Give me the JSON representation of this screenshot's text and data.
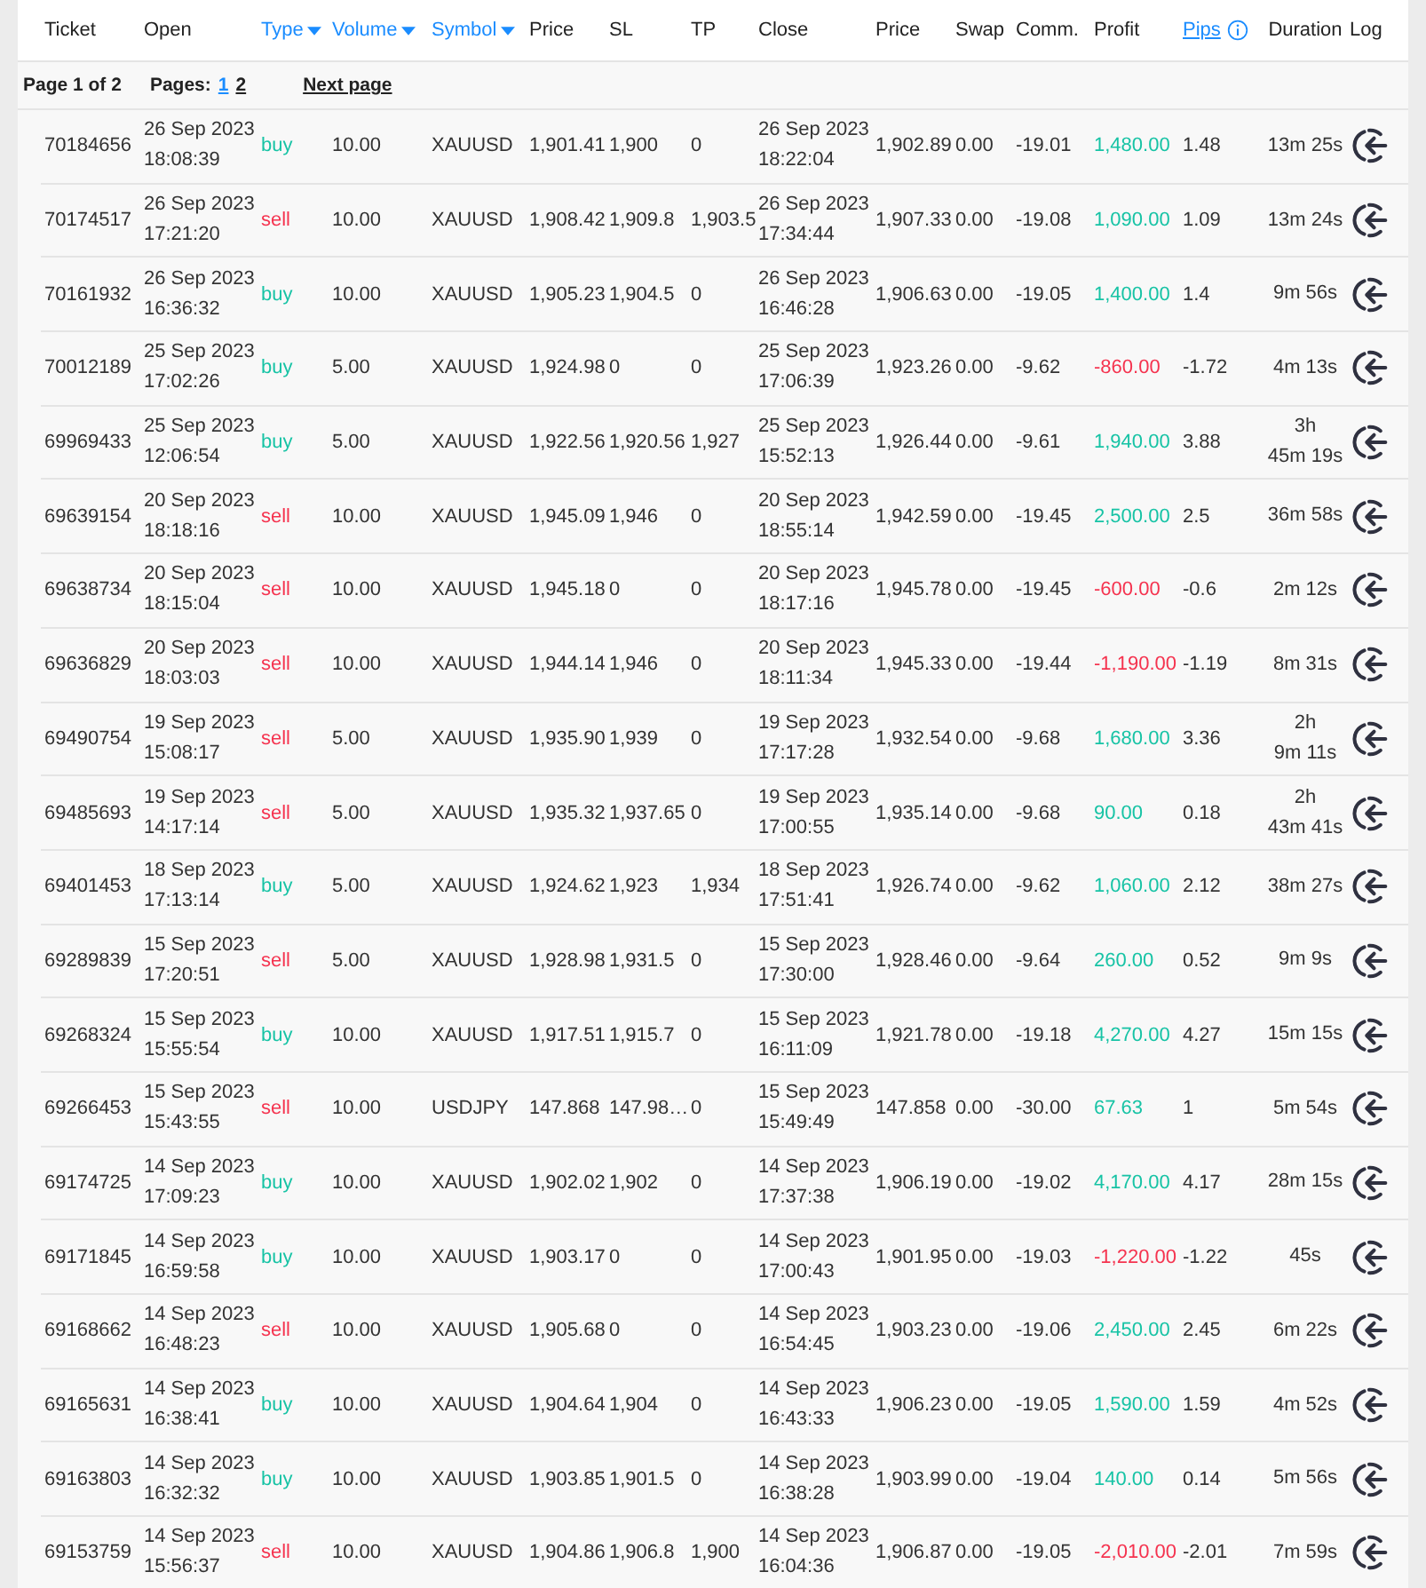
{
  "columns": [
    {
      "label": "Ticket",
      "kind": "plain"
    },
    {
      "label": "Open",
      "kind": "plain"
    },
    {
      "label": "Type",
      "kind": "sort"
    },
    {
      "label": "Volume",
      "kind": "sort"
    },
    {
      "label": "Symbol",
      "kind": "sort"
    },
    {
      "label": "Price",
      "kind": "plain"
    },
    {
      "label": "SL",
      "kind": "plain"
    },
    {
      "label": "TP",
      "kind": "plain"
    },
    {
      "label": "Close",
      "kind": "plain"
    },
    {
      "label": "Price",
      "kind": "plain"
    },
    {
      "label": "Swap",
      "kind": "plain"
    },
    {
      "label": "Comm.",
      "kind": "plain"
    },
    {
      "label": "Profit",
      "kind": "plain"
    },
    {
      "label": "Pips",
      "kind": "info"
    },
    {
      "label": "Duration",
      "kind": "plain"
    },
    {
      "label": "Log",
      "kind": "plain"
    }
  ],
  "pagination": {
    "summary": "Page 1 of 2",
    "pages_label": "Pages:",
    "pages": [
      {
        "label": "1",
        "selected": true
      },
      {
        "label": "2",
        "selected": false
      }
    ],
    "next": "Next page"
  },
  "rows": [
    {
      "ticket": "70184656",
      "open": "26 Sep 2023\n18:08:39",
      "type": {
        "text": "buy",
        "color": "#17c3a5"
      },
      "volume": "10.00",
      "symbol": "XAUUSD",
      "price": "1,901.41",
      "sl": "1,900",
      "tp": "0",
      "close": "26 Sep 2023\n18:22:04",
      "close_price": "1,902.89",
      "swap": "0.00",
      "comm": "-19.01",
      "profit": {
        "text": "1,480.00",
        "color": "#17c3a5"
      },
      "pips": "1.48",
      "duration": "13m 25s"
    },
    {
      "ticket": "70174517",
      "open": "26 Sep 2023\n17:21:20",
      "type": {
        "text": "sell",
        "color": "#f5334f"
      },
      "volume": "10.00",
      "symbol": "XAUUSD",
      "price": "1,908.42",
      "sl": "1,909.8",
      "tp": "1,903.5",
      "close": "26 Sep 2023\n17:34:44",
      "close_price": "1,907.33",
      "swap": "0.00",
      "comm": "-19.08",
      "profit": {
        "text": "1,090.00",
        "color": "#17c3a5"
      },
      "pips": "1.09",
      "duration": "13m 24s"
    },
    {
      "ticket": "70161932",
      "open": "26 Sep 2023\n16:36:32",
      "type": {
        "text": "buy",
        "color": "#17c3a5"
      },
      "volume": "10.00",
      "symbol": "XAUUSD",
      "price": "1,905.23",
      "sl": "1,904.5",
      "tp": "0",
      "close": "26 Sep 2023\n16:46:28",
      "close_price": "1,906.63",
      "swap": "0.00",
      "comm": "-19.05",
      "profit": {
        "text": "1,400.00",
        "color": "#17c3a5"
      },
      "pips": "1.4",
      "duration": "9m 56s"
    },
    {
      "ticket": "70012189",
      "open": "25 Sep 2023\n17:02:26",
      "type": {
        "text": "buy",
        "color": "#17c3a5"
      },
      "volume": "5.00",
      "symbol": "XAUUSD",
      "price": "1,924.98",
      "sl": "0",
      "tp": "0",
      "close": "25 Sep 2023\n17:06:39",
      "close_price": "1,923.26",
      "swap": "0.00",
      "comm": "-9.62",
      "profit": {
        "text": "-860.00",
        "color": "#f5334f"
      },
      "pips": "-1.72",
      "duration": "4m 13s"
    },
    {
      "ticket": "69969433",
      "open": "25 Sep 2023\n12:06:54",
      "type": {
        "text": "buy",
        "color": "#17c3a5"
      },
      "volume": "5.00",
      "symbol": "XAUUSD",
      "price": "1,922.56",
      "sl": "1,920.56",
      "tp": "1,927",
      "close": "25 Sep 2023\n15:52:13",
      "close_price": "1,926.44",
      "swap": "0.00",
      "comm": "-9.61",
      "profit": {
        "text": "1,940.00",
        "color": "#17c3a5"
      },
      "pips": "3.88",
      "duration": "3h\n45m 19s"
    },
    {
      "ticket": "69639154",
      "open": "20 Sep 2023\n18:18:16",
      "type": {
        "text": "sell",
        "color": "#f5334f"
      },
      "volume": "10.00",
      "symbol": "XAUUSD",
      "price": "1,945.09",
      "sl": "1,946",
      "tp": "0",
      "close": "20 Sep 2023\n18:55:14",
      "close_price": "1,942.59",
      "swap": "0.00",
      "comm": "-19.45",
      "profit": {
        "text": "2,500.00",
        "color": "#17c3a5"
      },
      "pips": "2.5",
      "duration": "36m 58s"
    },
    {
      "ticket": "69638734",
      "open": "20 Sep 2023\n18:15:04",
      "type": {
        "text": "sell",
        "color": "#f5334f"
      },
      "volume": "10.00",
      "symbol": "XAUUSD",
      "price": "1,945.18",
      "sl": "0",
      "tp": "0",
      "close": "20 Sep 2023\n18:17:16",
      "close_price": "1,945.78",
      "swap": "0.00",
      "comm": "-19.45",
      "profit": {
        "text": "-600.00",
        "color": "#f5334f"
      },
      "pips": "-0.6",
      "duration": "2m 12s"
    },
    {
      "ticket": "69636829",
      "open": "20 Sep 2023\n18:03:03",
      "type": {
        "text": "sell",
        "color": "#f5334f"
      },
      "volume": "10.00",
      "symbol": "XAUUSD",
      "price": "1,944.14",
      "sl": "1,946",
      "tp": "0",
      "close": "20 Sep 2023\n18:11:34",
      "close_price": "1,945.33",
      "swap": "0.00",
      "comm": "-19.44",
      "profit": {
        "text": "-1,190.00",
        "color": "#f5334f"
      },
      "pips": "-1.19",
      "duration": "8m 31s"
    },
    {
      "ticket": "69490754",
      "open": "19 Sep 2023\n15:08:17",
      "type": {
        "text": "sell",
        "color": "#f5334f"
      },
      "volume": "5.00",
      "symbol": "XAUUSD",
      "price": "1,935.90",
      "sl": "1,939",
      "tp": "0",
      "close": "19 Sep 2023\n17:17:28",
      "close_price": "1,932.54",
      "swap": "0.00",
      "comm": "-9.68",
      "profit": {
        "text": "1,680.00",
        "color": "#17c3a5"
      },
      "pips": "3.36",
      "duration": "2h\n9m 11s"
    },
    {
      "ticket": "69485693",
      "open": "19 Sep 2023\n14:17:14",
      "type": {
        "text": "sell",
        "color": "#f5334f"
      },
      "volume": "5.00",
      "symbol": "XAUUSD",
      "price": "1,935.32",
      "sl": "1,937.65",
      "tp": "0",
      "close": "19 Sep 2023\n17:00:55",
      "close_price": "1,935.14",
      "swap": "0.00",
      "comm": "-9.68",
      "profit": {
        "text": "90.00",
        "color": "#17c3a5"
      },
      "pips": "0.18",
      "duration": "2h\n43m 41s"
    },
    {
      "ticket": "69401453",
      "open": "18 Sep 2023\n17:13:14",
      "type": {
        "text": "buy",
        "color": "#17c3a5"
      },
      "volume": "5.00",
      "symbol": "XAUUSD",
      "price": "1,924.62",
      "sl": "1,923",
      "tp": "1,934",
      "close": "18 Sep 2023\n17:51:41",
      "close_price": "1,926.74",
      "swap": "0.00",
      "comm": "-9.62",
      "profit": {
        "text": "1,060.00",
        "color": "#17c3a5"
      },
      "pips": "2.12",
      "duration": "38m 27s"
    },
    {
      "ticket": "69289839",
      "open": "15 Sep 2023\n17:20:51",
      "type": {
        "text": "sell",
        "color": "#f5334f"
      },
      "volume": "5.00",
      "symbol": "XAUUSD",
      "price": "1,928.98",
      "sl": "1,931.5",
      "tp": "0",
      "close": "15 Sep 2023\n17:30:00",
      "close_price": "1,928.46",
      "swap": "0.00",
      "comm": "-9.64",
      "profit": {
        "text": "260.00",
        "color": "#17c3a5"
      },
      "pips": "0.52",
      "duration": "9m 9s"
    },
    {
      "ticket": "69268324",
      "open": "15 Sep 2023\n15:55:54",
      "type": {
        "text": "buy",
        "color": "#17c3a5"
      },
      "volume": "10.00",
      "symbol": "XAUUSD",
      "price": "1,917.51",
      "sl": "1,915.7",
      "tp": "0",
      "close": "15 Sep 2023\n16:11:09",
      "close_price": "1,921.78",
      "swap": "0.00",
      "comm": "-19.18",
      "profit": {
        "text": "4,270.00",
        "color": "#17c3a5"
      },
      "pips": "4.27",
      "duration": "15m 15s"
    },
    {
      "ticket": "69266453",
      "open": "15 Sep 2023\n15:43:55",
      "type": {
        "text": "sell",
        "color": "#f5334f"
      },
      "volume": "10.00",
      "symbol": "USDJPY",
      "price": "147.868",
      "sl": "147.98…",
      "tp": "0",
      "close": "15 Sep 2023\n15:49:49",
      "close_price": "147.858",
      "swap": "0.00",
      "comm": "-30.00",
      "profit": {
        "text": "67.63",
        "color": "#17c3a5"
      },
      "pips": "1",
      "duration": "5m 54s"
    },
    {
      "ticket": "69174725",
      "open": "14 Sep 2023\n17:09:23",
      "type": {
        "text": "buy",
        "color": "#17c3a5"
      },
      "volume": "10.00",
      "symbol": "XAUUSD",
      "price": "1,902.02",
      "sl": "1,902",
      "tp": "0",
      "close": "14 Sep 2023\n17:37:38",
      "close_price": "1,906.19",
      "swap": "0.00",
      "comm": "-19.02",
      "profit": {
        "text": "4,170.00",
        "color": "#17c3a5"
      },
      "pips": "4.17",
      "duration": "28m 15s"
    },
    {
      "ticket": "69171845",
      "open": "14 Sep 2023\n16:59:58",
      "type": {
        "text": "buy",
        "color": "#17c3a5"
      },
      "volume": "10.00",
      "symbol": "XAUUSD",
      "price": "1,903.17",
      "sl": "0",
      "tp": "0",
      "close": "14 Sep 2023\n17:00:43",
      "close_price": "1,901.95",
      "swap": "0.00",
      "comm": "-19.03",
      "profit": {
        "text": "-1,220.00",
        "color": "#f5334f"
      },
      "pips": "-1.22",
      "duration": "45s"
    },
    {
      "ticket": "69168662",
      "open": "14 Sep 2023\n16:48:23",
      "type": {
        "text": "sell",
        "color": "#f5334f"
      },
      "volume": "10.00",
      "symbol": "XAUUSD",
      "price": "1,905.68",
      "sl": "0",
      "tp": "0",
      "close": "14 Sep 2023\n16:54:45",
      "close_price": "1,903.23",
      "swap": "0.00",
      "comm": "-19.06",
      "profit": {
        "text": "2,450.00",
        "color": "#17c3a5"
      },
      "pips": "2.45",
      "duration": "6m 22s"
    },
    {
      "ticket": "69165631",
      "open": "14 Sep 2023\n16:38:41",
      "type": {
        "text": "buy",
        "color": "#17c3a5"
      },
      "volume": "10.00",
      "symbol": "XAUUSD",
      "price": "1,904.64",
      "sl": "1,904",
      "tp": "0",
      "close": "14 Sep 2023\n16:43:33",
      "close_price": "1,906.23",
      "swap": "0.00",
      "comm": "-19.05",
      "profit": {
        "text": "1,590.00",
        "color": "#17c3a5"
      },
      "pips": "1.59",
      "duration": "4m 52s"
    },
    {
      "ticket": "69163803",
      "open": "14 Sep 2023\n16:32:32",
      "type": {
        "text": "buy",
        "color": "#17c3a5"
      },
      "volume": "10.00",
      "symbol": "XAUUSD",
      "price": "1,903.85",
      "sl": "1,901.5",
      "tp": "0",
      "close": "14 Sep 2023\n16:38:28",
      "close_price": "1,903.99",
      "swap": "0.00",
      "comm": "-19.04",
      "profit": {
        "text": "140.00",
        "color": "#17c3a5"
      },
      "pips": "0.14",
      "duration": "5m 56s"
    },
    {
      "ticket": "69153759",
      "open": "14 Sep 2023\n15:56:37",
      "type": {
        "text": "sell",
        "color": "#f5334f"
      },
      "volume": "10.00",
      "symbol": "XAUUSD",
      "price": "1,904.86",
      "sl": "1,906.8",
      "tp": "1,900",
      "close": "14 Sep 2023\n16:04:36",
      "close_price": "1,906.87",
      "swap": "0.00",
      "comm": "-19.05",
      "profit": {
        "text": "-2,010.00",
        "color": "#f5334f"
      },
      "pips": "-2.01",
      "duration": "7m 59s"
    }
  ]
}
